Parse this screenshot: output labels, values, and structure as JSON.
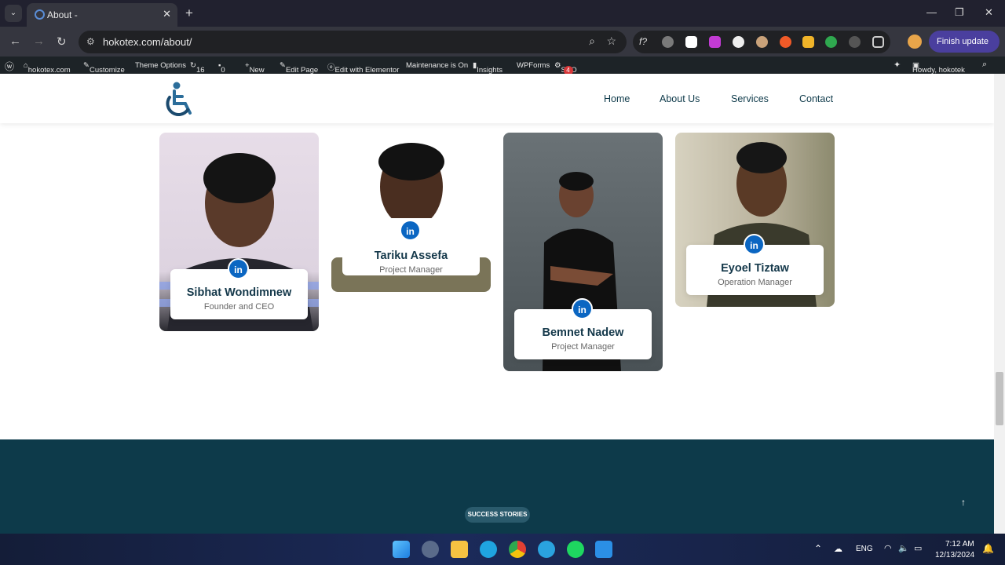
{
  "browser": {
    "tab_title": "About -",
    "url": "hokotex.com/about/",
    "finish_update": "Finish update"
  },
  "wp_admin": {
    "site": "hokotex.com",
    "customize": "Customize",
    "theme_options": "Theme Options",
    "updates": "16",
    "comments": "0",
    "new": "New",
    "edit_page": "Edit Page",
    "elementor": "Edit with Elementor",
    "maintenance": "Maintenance is On",
    "insights": "Insights",
    "wpforms": "WPForms",
    "seo": "SEO",
    "seo_badge": "4",
    "howdy": "Howdy, hokotek"
  },
  "nav": {
    "home": "Home",
    "about": "About Us",
    "services": "Services",
    "contact": "Contact"
  },
  "team": [
    {
      "name": "Sibhat Wondimnew",
      "role": "Founder and CEO",
      "linkedin": "in"
    },
    {
      "name": "Tariku Assefa",
      "role": "Project Manager",
      "linkedin": "in"
    },
    {
      "name": "Bemnet Nadew",
      "role": "Project Manager",
      "linkedin": "in"
    },
    {
      "name": "Eyoel Tiztaw",
      "role": "Operation Manager",
      "linkedin": "in"
    }
  ],
  "footer": {
    "success_label": "SUCCESS STORIES",
    "up_arrow": "↑"
  },
  "taskbar": {
    "lang": "ENG",
    "time": "7:12 AM",
    "date": "12/13/2024"
  },
  "colors": {
    "primary": "#0e3a4a",
    "linkedin": "#0b66c2",
    "footer_bg": "#0d3a4a"
  }
}
